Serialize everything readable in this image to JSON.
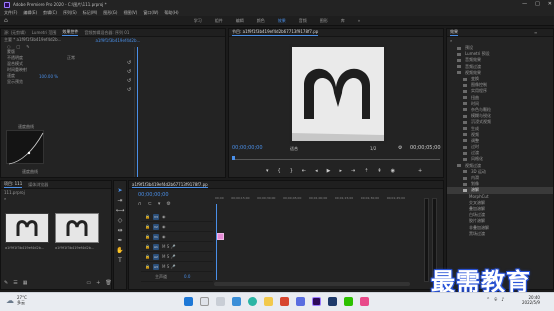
{
  "window": {
    "title": "Adobe Premiere Pro 2020 - C:\\图片\\111.prproj *"
  },
  "menu": [
    "文件(F)",
    "编辑(E)",
    "剪辑(C)",
    "序列(S)",
    "标记(M)",
    "图形(G)",
    "视图(V)",
    "窗口(W)",
    "帮助(H)"
  ],
  "workspaces": [
    "学习",
    "组件",
    "编辑",
    "颜色",
    "效果",
    "音频",
    "图形",
    "库"
  ],
  "active_workspace_label": "效果",
  "source_panel": {
    "tabs": [
      "源: (无剪辑)",
      "Lumetri 范围",
      "效果控件",
      "音频剪辑混合器: 序列 01"
    ],
    "clip": "主要 * a1f9f1f3b419ef4d2b...",
    "seq": "a1f9f1f3b419ef4d2b...",
    "rows": [
      "蒙版",
      "不透明度",
      "混合模式",
      "时间重映射",
      "速度",
      "显示预览"
    ],
    "mode": "正常",
    "graph_label": "速度曲线",
    "bottom_label": "速度曲线"
  },
  "program": {
    "title": "节目: a1f9f1f3b419ef4d2b67713f9178f7.pp",
    "tc_left": "00;00;00;00",
    "fit": "适合",
    "scale": "1/2",
    "tc_right": "00;00;05;00"
  },
  "project": {
    "tabs": [
      "项目: 111",
      "媒体浏览器"
    ],
    "name": "111.prproj",
    "items": [
      {
        "name": "a1f9f1f3b419ef4d2b...",
        "dur": "5:00"
      },
      {
        "name": "a1f9f1f3b419ef4d2b...",
        "dur": "5:00"
      }
    ]
  },
  "timeline": {
    "seq": "a1f9f1f3b419ef4d2b67713f9178f7.pp",
    "tc": "00;00;00;00",
    "ruler": [
      "00;00",
      "00;00;15;00",
      "00;00;30;00",
      "00;00;45;00",
      "00;01;00;00",
      "00;01;15;00",
      "00;01;30;00",
      "00;01;45;00"
    ],
    "tracks": [
      "V3",
      "V2",
      "V1",
      "A1",
      "A2",
      "A3",
      "主声道"
    ],
    "master_val": "0.0"
  },
  "effects": {
    "title": "效果",
    "items": [
      "预设",
      "Lumetri 预设",
      "音频效果",
      "音频过渡",
      "视频效果",
      "变换",
      "图像控制",
      "实用程序",
      "扭曲",
      "时间",
      "杂色与颗粒",
      "模糊与锐化",
      "沉浸式视频",
      "生成",
      "视频",
      "调整",
      "过时",
      "过渡",
      "风格化",
      "视频过渡",
      "3D 运动",
      "内滑",
      "划像",
      "溶解",
      "沉浸式视频",
      "擦除",
      "缩放",
      "页面剥落"
    ],
    "selected_label": "溶解",
    "subs": [
      "MorphCut",
      "交叉溶解",
      "叠加溶解",
      "白场过渡",
      "胶片溶解",
      "非叠加溶解",
      "黑场过渡"
    ]
  },
  "watermark": "最需教育",
  "taskbar": {
    "weather": "27°C",
    "weather_sub": "多云",
    "time": "20:40",
    "date": "2022/5/9"
  }
}
